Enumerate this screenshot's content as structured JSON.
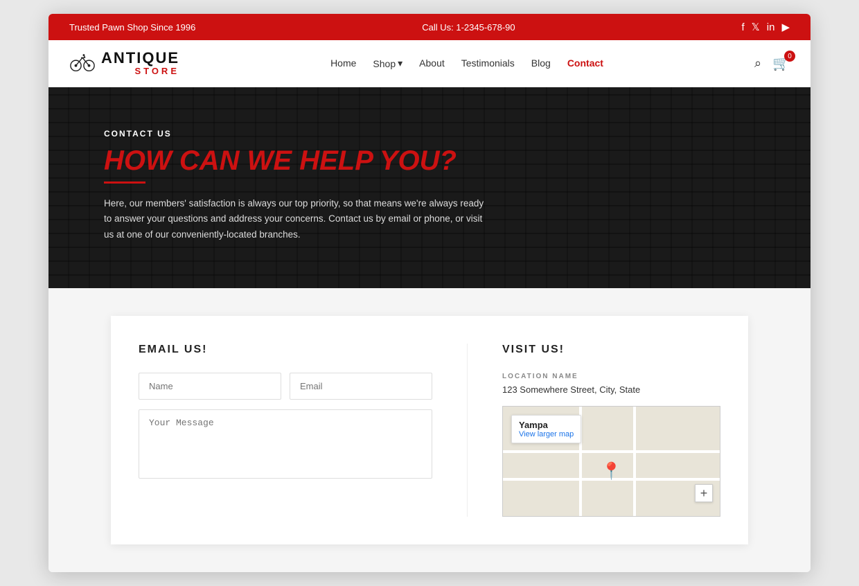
{
  "topBar": {
    "tagline": "Trusted Pawn Shop Since 1996",
    "phone": "Call Us: 1-2345-678-90",
    "social": [
      "f",
      "t",
      "in",
      "yt"
    ]
  },
  "nav": {
    "logo": {
      "antique": "ANTIQUE",
      "store": "STORE"
    },
    "links": [
      {
        "label": "Home",
        "active": false
      },
      {
        "label": "Shop",
        "active": false,
        "dropdown": true
      },
      {
        "label": "About",
        "active": false
      },
      {
        "label": "Testimonials",
        "active": false
      },
      {
        "label": "Blog",
        "active": false
      },
      {
        "label": "Contact",
        "active": true
      }
    ],
    "cartCount": "0"
  },
  "hero": {
    "eyebrow": "CONTACT US",
    "title": "HOW CAN WE HELP YOU?",
    "description": "Here, our members' satisfaction is always our top priority, so that means we're always ready to answer your questions and address your concerns. Contact us by email or phone, or visit us at one of our conveniently-located branches."
  },
  "emailSection": {
    "title": "EMAIL US!",
    "namePlaceholder": "Name",
    "emailPlaceholder": "Email",
    "messagePlaceholder": "Your Message"
  },
  "visitSection": {
    "title": "VISIT US!",
    "locationLabel": "LOCATION NAME",
    "address": "123 Somewhere Street, City, State",
    "mapPlace": "Yampa",
    "mapLink": "View larger map",
    "mapZoom": "+"
  }
}
